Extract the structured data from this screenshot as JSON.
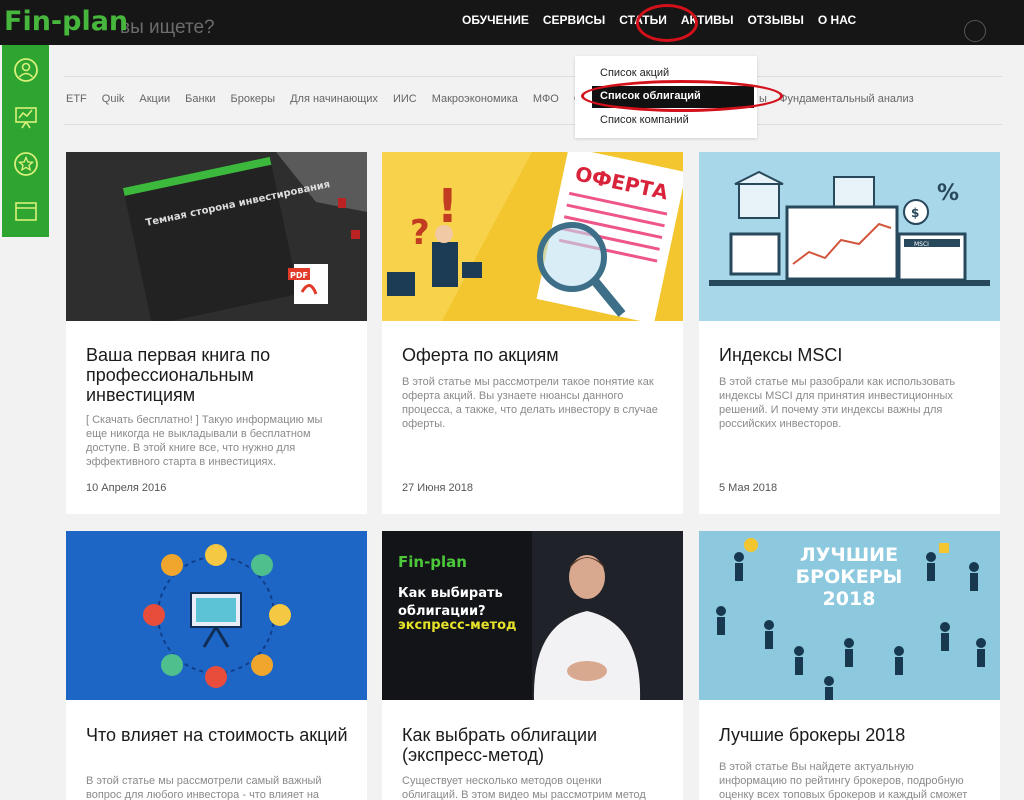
{
  "header": {
    "logo": "Fin-plan",
    "search_placeholder": "вы ищете?",
    "nav": [
      "ОБУЧЕНИЕ",
      "СЕРВИСЫ",
      "СТАТЬИ",
      "АКТИВЫ",
      "ОТЗЫВЫ",
      "О НАС"
    ]
  },
  "tags": [
    "ETF",
    "Quik",
    "Акции",
    "Банки",
    "Брокеры",
    "Для начинающих",
    "ИИС",
    "Макроэкономика",
    "МФО",
    "О"
  ],
  "tags_right": "Фундаментальный анализ",
  "tags_partial": "ы",
  "dropdown": [
    "Список акций",
    "Список облигаций",
    "Список компаний"
  ],
  "cards": [
    {
      "title": "Ваша первая книга по профессиональным инвестициям",
      "excerpt": "[ Скачать бесплатно! ] Такую информацию мы еще никогда не выкладывали в бесплатном доступе. В этой книге все, что нужно для эффективного старта в инвестициях.",
      "date": "10 Апреля 2016",
      "book_title": "Темная сторона инвестирования",
      "pdf_label": "PDF"
    },
    {
      "title": "Оферта по акциям",
      "excerpt": "В этой статье мы рассмотрели такое понятие как оферта акций. Вы узнаете нюансы данного процесса, а также, что делать инвестору в случае оферты.",
      "date": "27 Июня 2018",
      "image_text": "ОФЕРТА"
    },
    {
      "title": "Индексы MSCI",
      "excerpt": "В этой статье мы разобрали как использовать индексы MSCI для принятия инвестиционных решений. И почему эти индексы важны для российских инвесторов.",
      "date": "5 Мая 2018",
      "image_text": "MSCI"
    },
    {
      "title": "Что влияет на стоимость акций",
      "excerpt": "В этой статье мы рассмотрели самый важный вопрос для любого инвестора - что влияет на",
      "date": ""
    },
    {
      "title": "Как выбрать облигации (экспресс-метод)",
      "excerpt": "Существует несколько методов оценки облигаций. В этом видео мы рассмотрим метод",
      "date": "",
      "image_logo": "Fin-plan",
      "image_line1": "Как выбирать",
      "image_line2": "облигации?",
      "image_line3": "экспресс-метод"
    },
    {
      "title": "Лучшие брокеры 2018",
      "excerpt": "В этой статье Вы найдете актуальную информацию по рейтингу брокеров, подробную оценку всех топовых брокеров и каждый сможет",
      "date": "",
      "image_line1": "ЛУЧШИЕ",
      "image_line2": "БРОКЕРЫ",
      "image_line3": "2018"
    }
  ],
  "colors": {
    "brand_green": "#2da530",
    "highlight_red": "#d4111a",
    "topbar": "#161616"
  }
}
